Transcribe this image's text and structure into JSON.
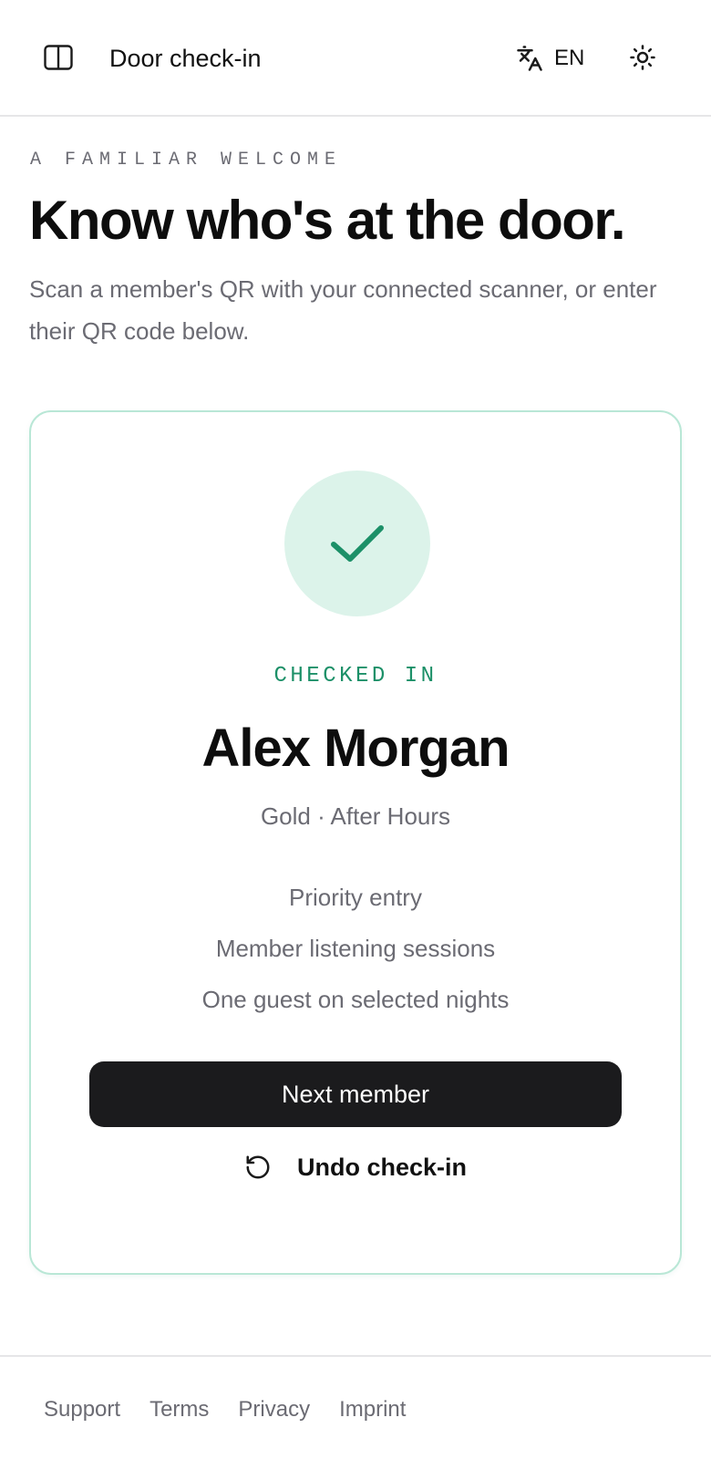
{
  "header": {
    "title": "Door check-in",
    "language_code": "EN",
    "icons": {
      "sidebar": "sidebar-panel-icon",
      "language": "translate-icon",
      "theme": "sun-icon"
    }
  },
  "hero": {
    "eyebrow": "A FAMILIAR WELCOME",
    "headline": "Know who's at the door.",
    "lead": "Scan a member's QR with your connected scanner, or enter their QR code below."
  },
  "result": {
    "status": "CHECKED IN",
    "status_icon": "check-icon",
    "member_name": "Alex Morgan",
    "tier": "Gold · After Hours",
    "perks": [
      "Priority entry",
      "Member listening sessions",
      "One guest on selected nights"
    ],
    "next_label": "Next member",
    "undo_label": "Undo check-in",
    "undo_icon": "rotate-ccw-icon"
  },
  "footer": {
    "links": [
      "Support",
      "Terms",
      "Privacy",
      "Imprint"
    ]
  },
  "colors": {
    "accent": "#1c9068",
    "accent_soft": "#dcf3ea",
    "card_border": "#b9e7d6",
    "button_dark": "#1b1b1d",
    "muted_text": "#6b6b73"
  }
}
